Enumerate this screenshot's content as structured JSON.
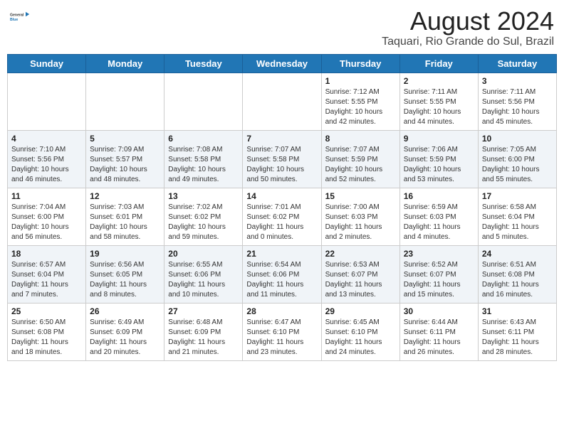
{
  "header": {
    "logo_general": "General",
    "logo_blue": "Blue",
    "main_title": "August 2024",
    "sub_title": "Taquari, Rio Grande do Sul, Brazil"
  },
  "weekdays": [
    "Sunday",
    "Monday",
    "Tuesday",
    "Wednesday",
    "Thursday",
    "Friday",
    "Saturday"
  ],
  "weeks": [
    [
      {
        "day": "",
        "info": ""
      },
      {
        "day": "",
        "info": ""
      },
      {
        "day": "",
        "info": ""
      },
      {
        "day": "",
        "info": ""
      },
      {
        "day": "1",
        "info": "Sunrise: 7:12 AM\nSunset: 5:55 PM\nDaylight: 10 hours\nand 42 minutes."
      },
      {
        "day": "2",
        "info": "Sunrise: 7:11 AM\nSunset: 5:55 PM\nDaylight: 10 hours\nand 44 minutes."
      },
      {
        "day": "3",
        "info": "Sunrise: 7:11 AM\nSunset: 5:56 PM\nDaylight: 10 hours\nand 45 minutes."
      }
    ],
    [
      {
        "day": "4",
        "info": "Sunrise: 7:10 AM\nSunset: 5:56 PM\nDaylight: 10 hours\nand 46 minutes."
      },
      {
        "day": "5",
        "info": "Sunrise: 7:09 AM\nSunset: 5:57 PM\nDaylight: 10 hours\nand 48 minutes."
      },
      {
        "day": "6",
        "info": "Sunrise: 7:08 AM\nSunset: 5:58 PM\nDaylight: 10 hours\nand 49 minutes."
      },
      {
        "day": "7",
        "info": "Sunrise: 7:07 AM\nSunset: 5:58 PM\nDaylight: 10 hours\nand 50 minutes."
      },
      {
        "day": "8",
        "info": "Sunrise: 7:07 AM\nSunset: 5:59 PM\nDaylight: 10 hours\nand 52 minutes."
      },
      {
        "day": "9",
        "info": "Sunrise: 7:06 AM\nSunset: 5:59 PM\nDaylight: 10 hours\nand 53 minutes."
      },
      {
        "day": "10",
        "info": "Sunrise: 7:05 AM\nSunset: 6:00 PM\nDaylight: 10 hours\nand 55 minutes."
      }
    ],
    [
      {
        "day": "11",
        "info": "Sunrise: 7:04 AM\nSunset: 6:00 PM\nDaylight: 10 hours\nand 56 minutes."
      },
      {
        "day": "12",
        "info": "Sunrise: 7:03 AM\nSunset: 6:01 PM\nDaylight: 10 hours\nand 58 minutes."
      },
      {
        "day": "13",
        "info": "Sunrise: 7:02 AM\nSunset: 6:02 PM\nDaylight: 10 hours\nand 59 minutes."
      },
      {
        "day": "14",
        "info": "Sunrise: 7:01 AM\nSunset: 6:02 PM\nDaylight: 11 hours\nand 0 minutes."
      },
      {
        "day": "15",
        "info": "Sunrise: 7:00 AM\nSunset: 6:03 PM\nDaylight: 11 hours\nand 2 minutes."
      },
      {
        "day": "16",
        "info": "Sunrise: 6:59 AM\nSunset: 6:03 PM\nDaylight: 11 hours\nand 4 minutes."
      },
      {
        "day": "17",
        "info": "Sunrise: 6:58 AM\nSunset: 6:04 PM\nDaylight: 11 hours\nand 5 minutes."
      }
    ],
    [
      {
        "day": "18",
        "info": "Sunrise: 6:57 AM\nSunset: 6:04 PM\nDaylight: 11 hours\nand 7 minutes."
      },
      {
        "day": "19",
        "info": "Sunrise: 6:56 AM\nSunset: 6:05 PM\nDaylight: 11 hours\nand 8 minutes."
      },
      {
        "day": "20",
        "info": "Sunrise: 6:55 AM\nSunset: 6:06 PM\nDaylight: 11 hours\nand 10 minutes."
      },
      {
        "day": "21",
        "info": "Sunrise: 6:54 AM\nSunset: 6:06 PM\nDaylight: 11 hours\nand 11 minutes."
      },
      {
        "day": "22",
        "info": "Sunrise: 6:53 AM\nSunset: 6:07 PM\nDaylight: 11 hours\nand 13 minutes."
      },
      {
        "day": "23",
        "info": "Sunrise: 6:52 AM\nSunset: 6:07 PM\nDaylight: 11 hours\nand 15 minutes."
      },
      {
        "day": "24",
        "info": "Sunrise: 6:51 AM\nSunset: 6:08 PM\nDaylight: 11 hours\nand 16 minutes."
      }
    ],
    [
      {
        "day": "25",
        "info": "Sunrise: 6:50 AM\nSunset: 6:08 PM\nDaylight: 11 hours\nand 18 minutes."
      },
      {
        "day": "26",
        "info": "Sunrise: 6:49 AM\nSunset: 6:09 PM\nDaylight: 11 hours\nand 20 minutes."
      },
      {
        "day": "27",
        "info": "Sunrise: 6:48 AM\nSunset: 6:09 PM\nDaylight: 11 hours\nand 21 minutes."
      },
      {
        "day": "28",
        "info": "Sunrise: 6:47 AM\nSunset: 6:10 PM\nDaylight: 11 hours\nand 23 minutes."
      },
      {
        "day": "29",
        "info": "Sunrise: 6:45 AM\nSunset: 6:10 PM\nDaylight: 11 hours\nand 24 minutes."
      },
      {
        "day": "30",
        "info": "Sunrise: 6:44 AM\nSunset: 6:11 PM\nDaylight: 11 hours\nand 26 minutes."
      },
      {
        "day": "31",
        "info": "Sunrise: 6:43 AM\nSunset: 6:11 PM\nDaylight: 11 hours\nand 28 minutes."
      }
    ]
  ]
}
